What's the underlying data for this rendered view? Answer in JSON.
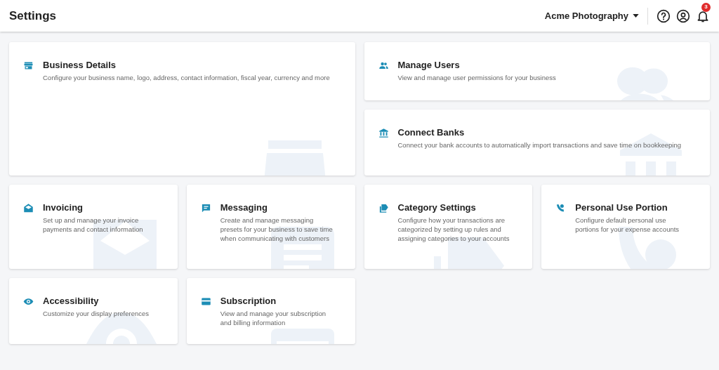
{
  "header": {
    "title": "Settings",
    "account": "Acme Photography",
    "notification_count": "3"
  },
  "cards": [
    {
      "kind": "store",
      "title": "Business Details",
      "description": "Configure your business name, logo, address, contact information, fiscal year, currency and more"
    },
    {
      "kind": "users",
      "title": "Manage Users",
      "description": "View and manage user permissions for your business"
    },
    {
      "kind": "bank",
      "title": "Connect Banks",
      "description": "Connect your bank accounts to automatically import transactions and save time on bookkeeping"
    },
    {
      "kind": "envelope",
      "title": "Invoicing",
      "description": "Set up and manage your invoice payments and contact information"
    },
    {
      "kind": "chat",
      "title": "Messaging",
      "description": "Create and manage messaging presets for your business to save time when communicating with customers"
    },
    {
      "kind": "tag",
      "title": "Category Settings",
      "description": "Configure how your transactions are categorized by setting up rules and assigning categories to your accounts"
    },
    {
      "kind": "person",
      "title": "Personal Use Portion",
      "description": "Configure default personal use portions for your expense accounts"
    },
    {
      "kind": "eye",
      "title": "Accessibility",
      "description": "Customize your display preferences"
    },
    {
      "kind": "card",
      "title": "Subscription",
      "description": "View and manage your subscription and billing information"
    }
  ]
}
